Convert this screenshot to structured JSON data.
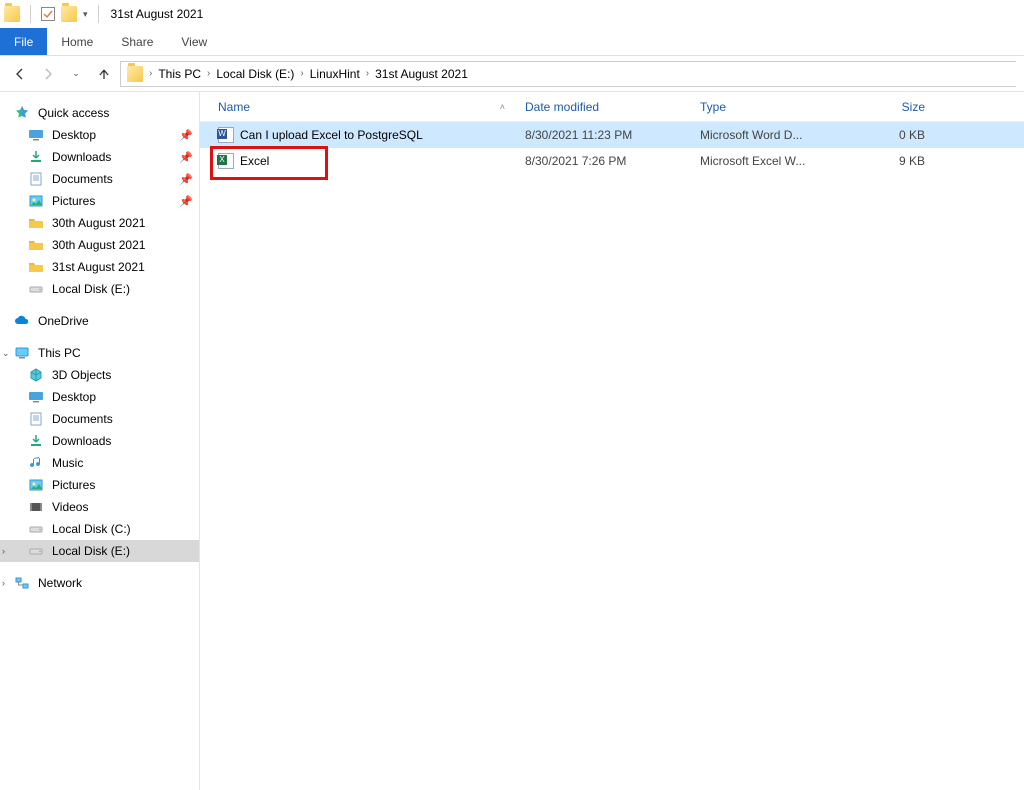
{
  "titlebar": {
    "title": "31st August 2021"
  },
  "ribbon": {
    "file": "File",
    "tabs": [
      "Home",
      "Share",
      "View"
    ]
  },
  "breadcrumbs": [
    "This PC",
    "Local Disk (E:)",
    "LinuxHint",
    "31st August 2021"
  ],
  "sidebar": {
    "quick_access": {
      "label": "Quick access",
      "items": [
        {
          "label": "Desktop",
          "icon": "desktop",
          "pinned": true
        },
        {
          "label": "Downloads",
          "icon": "download",
          "pinned": true
        },
        {
          "label": "Documents",
          "icon": "document",
          "pinned": true
        },
        {
          "label": "Pictures",
          "icon": "picture",
          "pinned": true
        },
        {
          "label": "30th August 2021",
          "icon": "folder"
        },
        {
          "label": "30th August 2021",
          "icon": "folder"
        },
        {
          "label": "31st August 2021",
          "icon": "folder"
        },
        {
          "label": "Local Disk (E:)",
          "icon": "drive"
        }
      ]
    },
    "onedrive": {
      "label": "OneDrive"
    },
    "this_pc": {
      "label": "This PC",
      "items": [
        {
          "label": "3D Objects",
          "icon": "cube"
        },
        {
          "label": "Desktop",
          "icon": "desktop"
        },
        {
          "label": "Documents",
          "icon": "document"
        },
        {
          "label": "Downloads",
          "icon": "download"
        },
        {
          "label": "Music",
          "icon": "music"
        },
        {
          "label": "Pictures",
          "icon": "picture"
        },
        {
          "label": "Videos",
          "icon": "video"
        },
        {
          "label": "Local Disk (C:)",
          "icon": "drive"
        },
        {
          "label": "Local Disk (E:)",
          "icon": "drive",
          "selected": true
        }
      ]
    },
    "network": {
      "label": "Network"
    }
  },
  "columns": {
    "name": "Name",
    "date": "Date modified",
    "type": "Type",
    "size": "Size",
    "sort": "name"
  },
  "files": [
    {
      "name": "Can I upload Excel to PostgreSQL",
      "date": "8/30/2021 11:23 PM",
      "type": "Microsoft Word D...",
      "size": "0 KB",
      "icon": "word",
      "selected": true
    },
    {
      "name": "Excel",
      "date": "8/30/2021 7:26 PM",
      "type": "Microsoft Excel W...",
      "size": "9 KB",
      "icon": "excel",
      "highlighted": true
    }
  ]
}
